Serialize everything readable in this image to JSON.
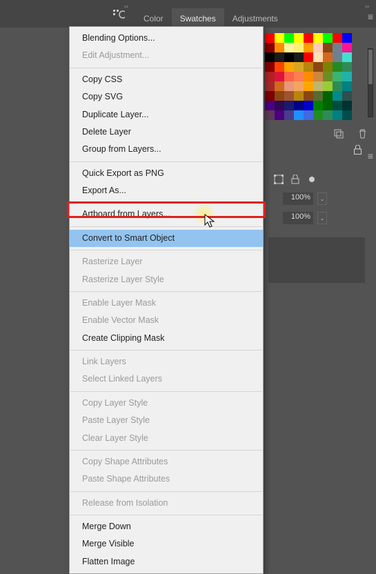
{
  "tabs": {
    "color": "Color",
    "swatches": "Swatches",
    "adjustments": "Adjustments"
  },
  "right_panel": {
    "percent1": "100%",
    "percent2": "100%"
  },
  "swatches": [
    "#ff0000",
    "#ffff00",
    "#00ff00",
    "#ffff00",
    "#ff0000",
    "#ffff00",
    "#00ff00",
    "#ff0000",
    "#0000ff",
    "#8b0000",
    "#ff8c00",
    "#fff59d",
    "#fff176",
    "#ffa000",
    "#ffccbc",
    "#8b4513",
    "#708090",
    "#ff1493",
    "#000000",
    "#1b1b1b",
    "#000000",
    "#1b1b1b",
    "#ff0000",
    "#ffe0b2",
    "#d2691e",
    "#708090",
    "#40e0d0",
    "#8b0000",
    "#ff4500",
    "#ffa500",
    "#daa520",
    "#b8860b",
    "#8b4513",
    "#808000",
    "#228b22",
    "#2e8b57",
    "#b22222",
    "#dc143c",
    "#ff6347",
    "#ff7f50",
    "#ff8c00",
    "#cd853f",
    "#6b8e23",
    "#3cb371",
    "#20b2aa",
    "#a52a2a",
    "#d2691e",
    "#e9967a",
    "#f4a460",
    "#ffa500",
    "#bdb76b",
    "#9acd32",
    "#2e8b57",
    "#008080",
    "#800000",
    "#8b4513",
    "#a0522d",
    "#b8860b",
    "#8b4513",
    "#556b2f",
    "#006400",
    "#008b8b",
    "#2f4f4f",
    "#4b0082",
    "#2e0854",
    "#191970",
    "#00008b",
    "#0000cd",
    "#008000",
    "#006400",
    "#004d40",
    "#003333",
    "#5d3954",
    "#4b0082",
    "#483d8b",
    "#1e90ff",
    "#4169e1",
    "#228b22",
    "#2e8b57",
    "#008080",
    "#004d4d"
  ],
  "menu": {
    "g1": [
      "Blending Options...",
      "Edit Adjustment..."
    ],
    "g2": [
      "Copy CSS",
      "Copy SVG",
      "Duplicate Layer...",
      "Delete Layer",
      "Group from Layers..."
    ],
    "g3": [
      "Quick Export as PNG",
      "Export As..."
    ],
    "g4": [
      "Artboard from Layers..."
    ],
    "g5": [
      "Convert to Smart Object"
    ],
    "g6": [
      "Rasterize Layer",
      "Rasterize Layer Style"
    ],
    "g7": [
      "Enable Layer Mask",
      "Enable Vector Mask",
      "Create Clipping Mask"
    ],
    "g8": [
      "Link Layers",
      "Select Linked Layers"
    ],
    "g9": [
      "Copy Layer Style",
      "Paste Layer Style",
      "Clear Layer Style"
    ],
    "g10": [
      "Copy Shape Attributes",
      "Paste Shape Attributes"
    ],
    "g11": [
      "Release from Isolation"
    ],
    "g12": [
      "Merge Down",
      "Merge Visible",
      "Flatten Image"
    ],
    "disabled": {
      "Edit Adjustment...": true,
      "Rasterize Layer": true,
      "Rasterize Layer Style": true,
      "Enable Layer Mask": true,
      "Enable Vector Mask": true,
      "Link Layers": true,
      "Select Linked Layers": true,
      "Copy Layer Style": true,
      "Paste Layer Style": true,
      "Clear Layer Style": true,
      "Copy Shape Attributes": true,
      "Paste Shape Attributes": true,
      "Release from Isolation": true
    },
    "highlighted": "Convert to Smart Object"
  }
}
